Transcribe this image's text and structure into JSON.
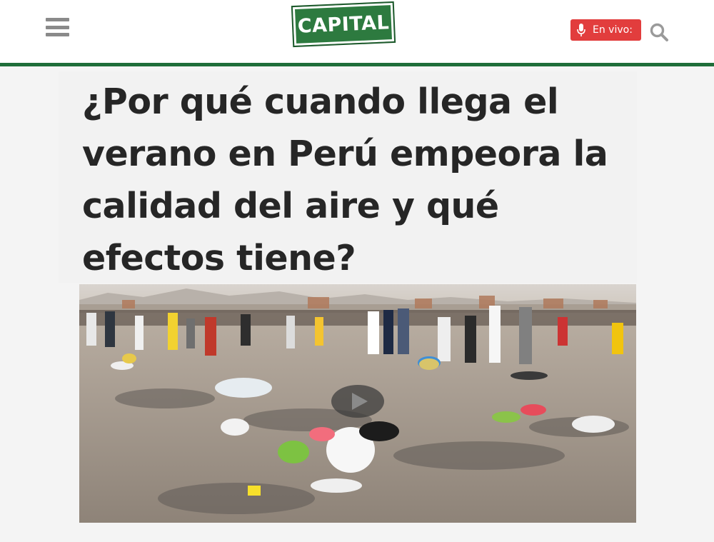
{
  "header": {
    "menu_icon": "hamburger-menu-icon",
    "logo_text": "CAPITAL",
    "live_button_label": "En vivo:",
    "mic_icon": "microphone-icon",
    "search_icon": "search-icon"
  },
  "article": {
    "title": "¿Por qué cuando llega el verano en Perú empeora la calidad del aire y qué efectos tiene?"
  },
  "media": {
    "play_icon": "play-icon"
  },
  "colors": {
    "brand_green": "#2d7a3f",
    "header_rule": "#1f6e3a",
    "live_red": "#e23d3d",
    "title_text": "#262626"
  }
}
